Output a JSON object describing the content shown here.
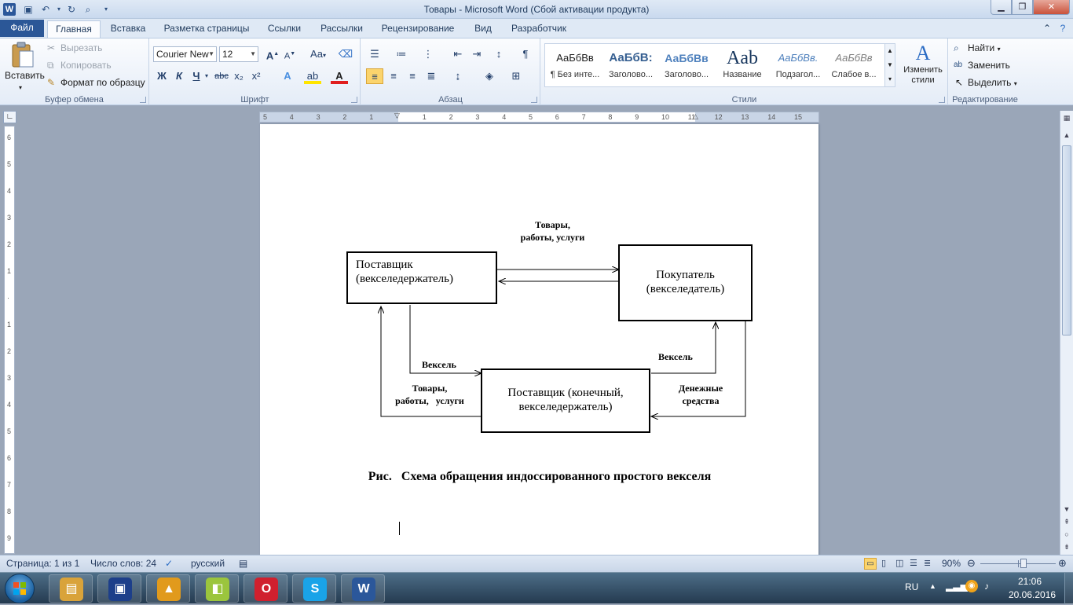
{
  "window": {
    "title": "Товары  -  Microsoft Word (Сбой активации продукта)",
    "app_icon": "W",
    "quick_access": [
      "save-icon",
      "undo-icon",
      "redo-icon",
      "print-preview-icon",
      "customize-icon"
    ],
    "controls": {
      "minimize": "▁",
      "maximize": "❐",
      "close": "✕"
    }
  },
  "tabs": {
    "file": "Файл",
    "items": [
      "Главная",
      "Вставка",
      "Разметка страницы",
      "Ссылки",
      "Рассылки",
      "Рецензирование",
      "Вид",
      "Разработчик"
    ],
    "active": "Главная"
  },
  "ribbon": {
    "clipboard": {
      "label": "Буфер обмена",
      "paste": "Вставить",
      "cut": "Вырезать",
      "copy": "Копировать",
      "format_painter": "Формат по образцу"
    },
    "font": {
      "label": "Шрифт",
      "name": "Courier New",
      "size": "12",
      "bold": "Ж",
      "italic": "К",
      "underline": "Ч",
      "strike": "abc",
      "sub": "x₂",
      "sup": "x²",
      "grow": "A",
      "shrink": "A",
      "case": "Aa"
    },
    "paragraph": {
      "label": "Абзац"
    },
    "styles": {
      "label": "Стили",
      "items": [
        {
          "preview": "АаБбВв",
          "name": "¶ Без инте...",
          "color": "#000000"
        },
        {
          "preview": "АаБбВ:",
          "name": "Заголово...",
          "color": "#365f91"
        },
        {
          "preview": "АаБбВв",
          "name": "Заголово...",
          "color": "#4f81bd"
        },
        {
          "preview": "Aab",
          "name": "Название",
          "color": "#17365d"
        },
        {
          "preview": "АаБбВв.",
          "name": "Подзагол...",
          "color": "#4f81bd"
        },
        {
          "preview": "АаБбВв",
          "name": "Слабое в...",
          "color": "#808080"
        }
      ],
      "change": "Изменить стили"
    },
    "editing": {
      "label": "Редактирование",
      "find": "Найти",
      "replace": "Заменить",
      "select": "Выделить"
    }
  },
  "hruler": [
    "5",
    "4",
    "3",
    "2",
    "1",
    "",
    "1",
    "2",
    "3",
    "4",
    "5",
    "6",
    "7",
    "8",
    "9",
    "10",
    "11",
    "12",
    "13",
    "14",
    "15"
  ],
  "vruler": [
    "6",
    "5",
    "4",
    "3",
    "2",
    "1",
    "",
    "1",
    "2",
    "3",
    "4",
    "5",
    "6",
    "7",
    "8",
    "9"
  ],
  "diagram": {
    "supplier": "Поставщик (векселедержатель)",
    "buyer": "Покупатель (векселедатель)",
    "final_supplier": "Поставщик (конечный, векселедержатель)",
    "goods_top": "Товары,\nработы, услуги",
    "bill_left": "Вексель",
    "bill_right": "Вексель",
    "goods_bottom": "Товары,\nработы,   услуги",
    "money": "Денежные\nсредства",
    "caption": "Рис.   Схема обращения индоссированного простого векселя"
  },
  "status": {
    "page": "Страница: 1 из 1",
    "words": "Число слов: 24",
    "language": "русский",
    "zoom": "90%",
    "zoom_fraction": 0.57
  },
  "taskbar": {
    "apps": [
      {
        "name": "explorer",
        "glyph": "▤",
        "color": "#d9a33a"
      },
      {
        "name": "save-app",
        "glyph": "▣",
        "color": "#1d3f8a"
      },
      {
        "name": "aimp",
        "glyph": "▲",
        "color": "#e19a1c"
      },
      {
        "name": "image-viewer",
        "glyph": "◧",
        "color": "#9bc53d"
      },
      {
        "name": "opera",
        "glyph": "O",
        "color": "#d0202e"
      },
      {
        "name": "skype",
        "glyph": "S",
        "color": "#1aa3e8"
      },
      {
        "name": "word",
        "glyph": "W",
        "color": "#2b579a"
      }
    ],
    "lang": "RU",
    "time": "21:06",
    "date": "20.06.2016"
  }
}
